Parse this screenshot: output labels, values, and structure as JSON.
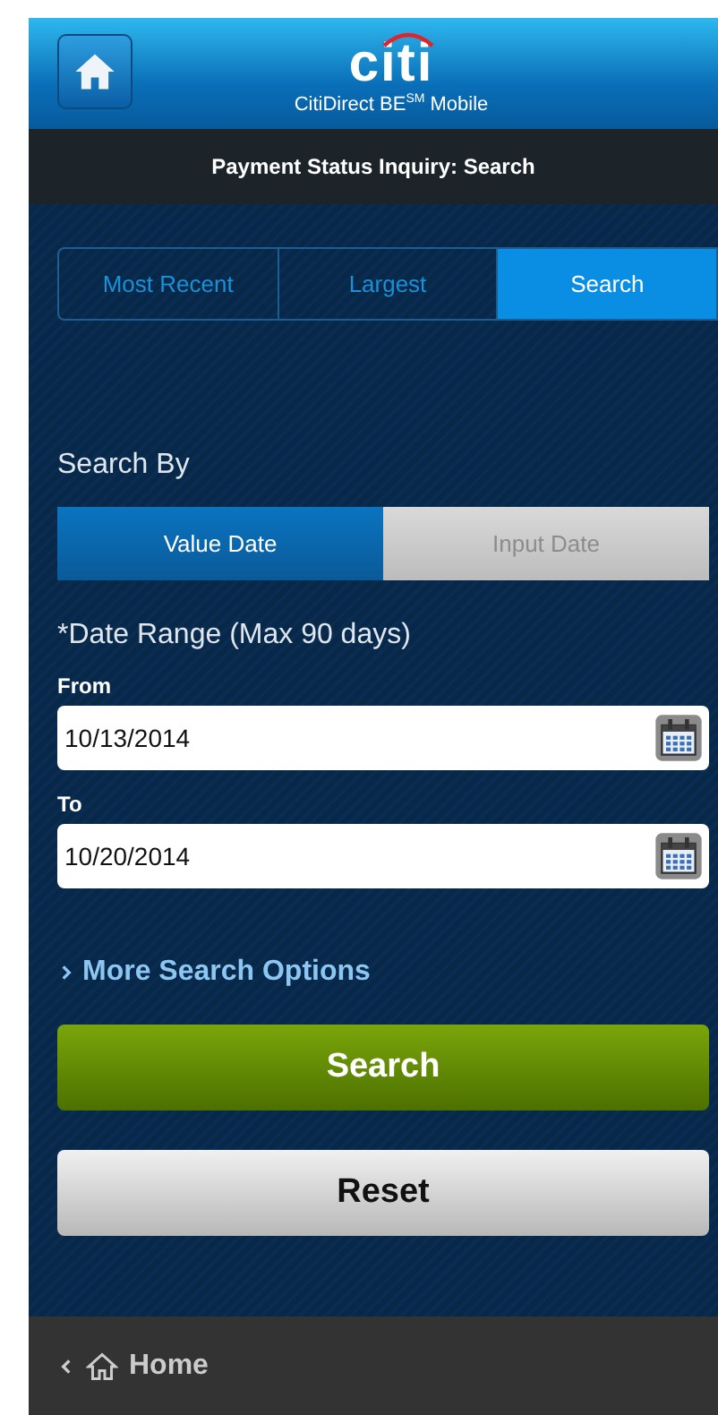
{
  "header": {
    "logo": "citi",
    "subtitle": "CitiDirect BE$^{SM}$ Mobile"
  },
  "title": "Payment Status Inquiry: Search",
  "tabs": [
    {
      "label": "Most Recent",
      "selected": false
    },
    {
      "label": "Largest",
      "selected": false
    },
    {
      "label": "Search",
      "selected": true
    }
  ],
  "search_by": {
    "label": "Search By",
    "options": [
      {
        "label": "Value Date",
        "selected": true
      },
      {
        "label": "Input Date",
        "selected": false
      }
    ]
  },
  "date_range": {
    "label": "*Date Range (Max 90 days)",
    "fields": [
      {
        "label": "From",
        "value": "10/13/2014"
      },
      {
        "label": "To",
        "value": "10/20/2014"
      }
    ]
  },
  "more_options": {
    "label": "More Search Options",
    "expanded": false
  },
  "buttons": [
    {
      "label": "Search",
      "kind": "primary"
    },
    {
      "label": "Reset",
      "kind": "secondary"
    }
  ],
  "footer": {
    "label": "Home"
  }
}
